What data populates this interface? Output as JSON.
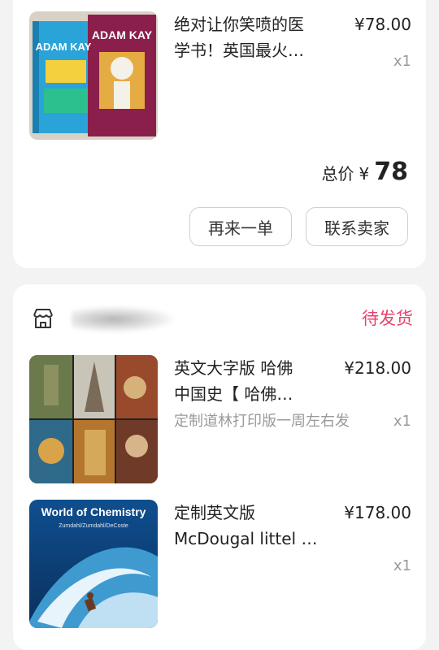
{
  "order1": {
    "item": {
      "title": "绝对让你笑喷的医\n学书！英国最火…",
      "price": "¥78.00",
      "qty": "x1",
      "cover_author": "ADAM KAY"
    },
    "total_label": "总价",
    "total_symbol": "¥",
    "total_value": "78",
    "buttons": {
      "again": "再来一单",
      "contact": "联系卖家"
    }
  },
  "order2": {
    "status": "待发货",
    "items": [
      {
        "title": "英文大字版 哈佛\n中国史【 哈佛…",
        "price": "¥218.00",
        "spec": "定制道林打印版一周左右发",
        "qty": "x1"
      },
      {
        "title": "定制英文版\nMcDougal littel …",
        "price": "¥178.00",
        "spec": "",
        "qty": "x1",
        "cover_title": "World of Chemistry",
        "cover_authors": "Zumdahl/Zumdahl/DeCoste"
      }
    ]
  },
  "colors": {
    "status": "#e8416c",
    "muted": "#9a9a9a",
    "background": "#f3f3f3"
  },
  "icons": {
    "shop": "shop-icon"
  }
}
